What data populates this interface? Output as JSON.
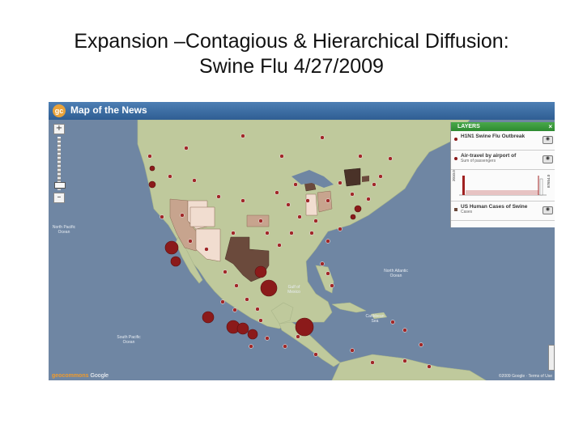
{
  "slide": {
    "title_line1": "Expansion –Contagious & Hierarchical Diffusion:",
    "title_line2": "Swine Flu 4/27/2009"
  },
  "map": {
    "header_title": "Map of the News",
    "logo_letters": "gc",
    "zoom_in": "+",
    "zoom_out": "–",
    "ocean_north_pacific": "North Pacific Ocean",
    "ocean_north_atlantic": "North Atlantic Ocean",
    "ocean_south_pacific": "South Pacific Ocean",
    "gulf_of_mexico": "Gulf of Mexico",
    "caribbean": "Caribbean Sea",
    "footer_left_brand": "geocommons",
    "footer_left_powered": "Google",
    "footer_right": "©2009 Google · Terms of Use",
    "colors": {
      "water": "#6f86a3",
      "land": "#bfc99c",
      "marker": "#8b1a1a",
      "state_dark": "#6b4a3c",
      "state_mid": "#c7a48e",
      "state_light": "#f1ddd0"
    }
  },
  "layers_panel": {
    "title": "LAYERS",
    "close": "×",
    "items": [
      {
        "name": "H1N1 Swine Flu Outbreak",
        "sub": ""
      },
      {
        "name": "Air-travel by airport of",
        "sub": "Sum of passengers"
      },
      {
        "name": "US Human Cases of Swine",
        "sub": "Cases"
      }
    ],
    "chart_min_label": "2010.0",
    "chart_max_label": "87654.0"
  }
}
